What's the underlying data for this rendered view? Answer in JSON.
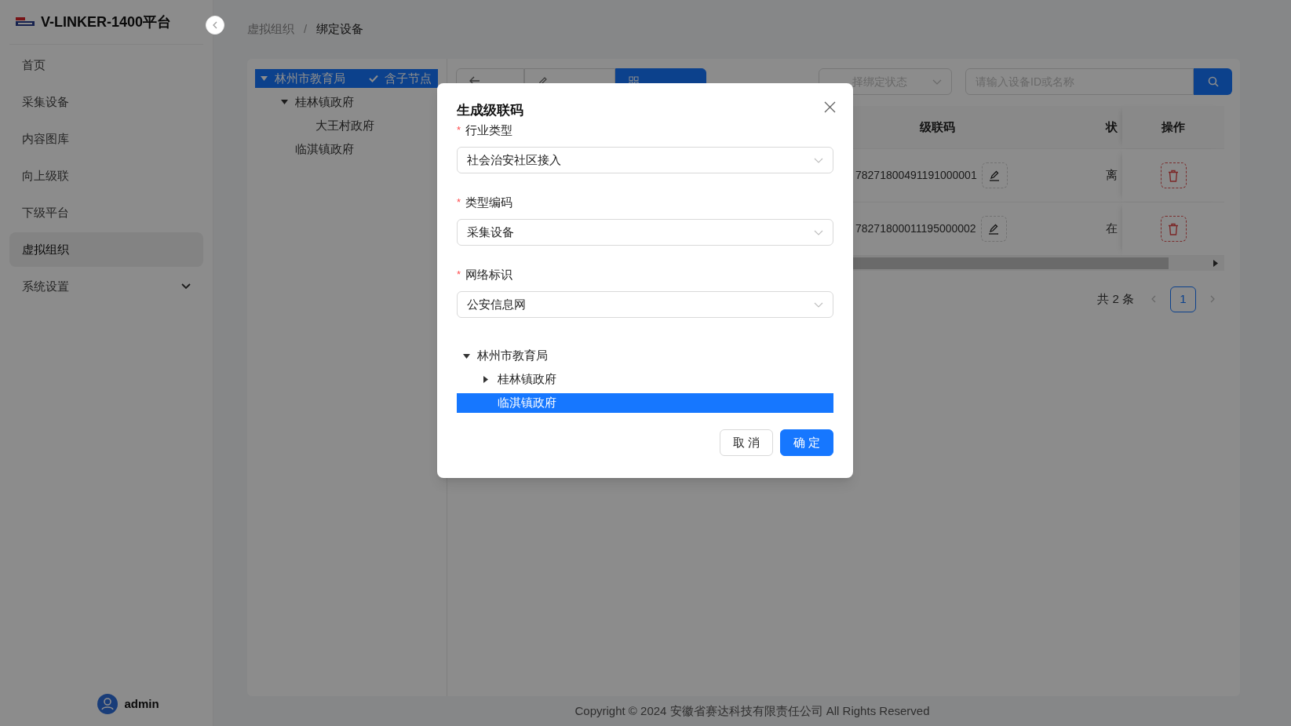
{
  "sidebar": {
    "brand": "V-LINKER-1400平台",
    "items": [
      {
        "label": "首页",
        "selected": false,
        "has_submenu": false
      },
      {
        "label": "采集设备",
        "selected": false,
        "has_submenu": false
      },
      {
        "label": "内容图库",
        "selected": false,
        "has_submenu": false
      },
      {
        "label": "向上级联",
        "selected": false,
        "has_submenu": false
      },
      {
        "label": "下级平台",
        "selected": false,
        "has_submenu": false
      },
      {
        "label": "虚拟组织",
        "selected": true,
        "has_submenu": false
      },
      {
        "label": "系统设置",
        "selected": false,
        "has_submenu": true
      }
    ],
    "user": "admin"
  },
  "breadcrumb": {
    "items": [
      "虚拟组织",
      "绑定设备"
    ],
    "separator": "/"
  },
  "org_tree": {
    "nodes": [
      {
        "label": "林州市教育局",
        "selected": true,
        "expanded": true,
        "children": [
          {
            "label": "桂林镇政府",
            "selected": false,
            "expanded": true,
            "children": [
              {
                "label": "大王村政府",
                "selected": false
              }
            ]
          },
          {
            "label": "临淇镇政府",
            "selected": false
          }
        ]
      }
    ],
    "include_children": {
      "label": "含子节点",
      "checked": true
    }
  },
  "toolbar": [
    {
      "kind": "back",
      "selected": false
    },
    {
      "kind": "edit",
      "selected": false
    },
    {
      "kind": "grid",
      "selected": true
    }
  ],
  "status_filter": {
    "placeholder": "择绑定状态"
  },
  "search": {
    "placeholder": "请输入设备ID或名称"
  },
  "table": {
    "columns": [
      "级联码",
      "状",
      "操作"
    ],
    "rows": [
      {
        "code": "78271800491191000001",
        "status": "离"
      },
      {
        "code": "78271800011195000002",
        "status": "在"
      }
    ]
  },
  "pagination": {
    "total": "共 2 条",
    "pages": [
      {
        "label": "1",
        "selected": true
      }
    ]
  },
  "dialog": {
    "title": "生成级联码",
    "fields": [
      {
        "label": "行业类型",
        "required_mark": "*",
        "value": "社会治安社区接入"
      },
      {
        "label": "类型编码",
        "required_mark": "*",
        "value": "采集设备"
      },
      {
        "label": "网络标识",
        "required_mark": "*",
        "value": "公安信息网"
      }
    ],
    "tree": [
      {
        "label": "林州市教育局",
        "selected": false,
        "expanded": true,
        "children": [
          {
            "label": "桂林镇政府",
            "selected": false,
            "expanded": false
          },
          {
            "label": "临淇镇政府",
            "selected": true
          }
        ]
      }
    ],
    "buttons": [
      {
        "kind": "secondary",
        "label": "取消"
      },
      {
        "kind": "primary",
        "label": "确定"
      }
    ]
  },
  "footer": "Copyright © 2024 安徽省赛达科技有限责任公司 All Rights Reserved"
}
